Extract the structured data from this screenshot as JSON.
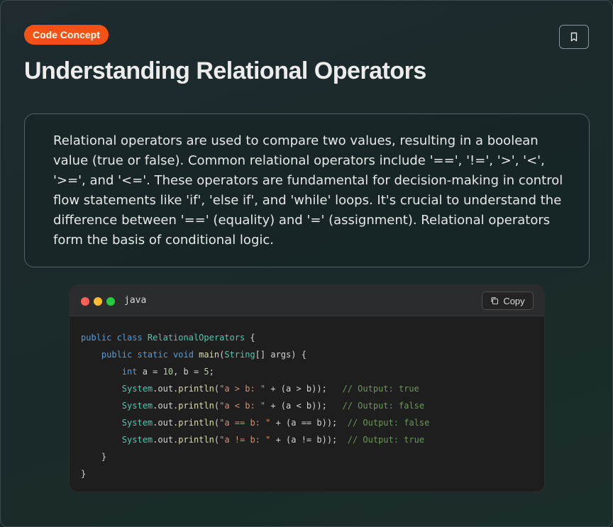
{
  "badge": {
    "label": "Code Concept"
  },
  "header": {
    "title": "Understanding Relational Operators",
    "bookmark_icon": "bookmark-icon"
  },
  "description": {
    "text": "Relational operators are used to compare two values, resulting in a boolean value (true or false). Common relational operators include '==', '!=', '>', '<', '>=', and '<='. These operators are fundamental for decision-making in control flow statements like 'if', 'else if', and 'while' loops. It's crucial to understand the difference between '==' (equality) and '=' (assignment). Relational operators form the basis of conditional logic."
  },
  "code_block": {
    "language": "java",
    "copy_label": "Copy",
    "copy_icon": "copy-icon",
    "window_dots": [
      "#ff5f56",
      "#ffbd2e",
      "#27c93f"
    ],
    "lines": [
      [
        {
          "t": "public class ",
          "c": "kw"
        },
        {
          "t": "RelationalOperators",
          "c": "ty"
        },
        {
          "t": " {",
          "c": ""
        }
      ],
      [
        {
          "t": "    public static void ",
          "c": "kw"
        },
        {
          "t": "main",
          "c": "fn"
        },
        {
          "t": "(",
          "c": ""
        },
        {
          "t": "String",
          "c": "ty"
        },
        {
          "t": "[] args) {",
          "c": ""
        }
      ],
      [
        {
          "t": "        ",
          "c": ""
        },
        {
          "t": "int",
          "c": "kw"
        },
        {
          "t": " a = ",
          "c": ""
        },
        {
          "t": "10",
          "c": "nu"
        },
        {
          "t": ", b = ",
          "c": ""
        },
        {
          "t": "5",
          "c": "nu"
        },
        {
          "t": ";",
          "c": ""
        }
      ],
      [
        {
          "t": "        ",
          "c": ""
        },
        {
          "t": "System",
          "c": "ty"
        },
        {
          "t": ".out.",
          "c": ""
        },
        {
          "t": "println",
          "c": "fn"
        },
        {
          "t": "(",
          "c": ""
        },
        {
          "t": "\"a > b: \"",
          "c": "st"
        },
        {
          "t": " + (a > b));   ",
          "c": ""
        },
        {
          "t": "// Output: true",
          "c": "cm"
        }
      ],
      [
        {
          "t": "        ",
          "c": ""
        },
        {
          "t": "System",
          "c": "ty"
        },
        {
          "t": ".out.",
          "c": ""
        },
        {
          "t": "println",
          "c": "fn"
        },
        {
          "t": "(",
          "c": ""
        },
        {
          "t": "\"a < b: \"",
          "c": "st"
        },
        {
          "t": " + (a < b));   ",
          "c": ""
        },
        {
          "t": "// Output: false",
          "c": "cm"
        }
      ],
      [
        {
          "t": "        ",
          "c": ""
        },
        {
          "t": "System",
          "c": "ty"
        },
        {
          "t": ".out.",
          "c": ""
        },
        {
          "t": "println",
          "c": "fn"
        },
        {
          "t": "(",
          "c": ""
        },
        {
          "t": "\"a == b: \"",
          "c": "st"
        },
        {
          "t": " + (a == b));  ",
          "c": ""
        },
        {
          "t": "// Output: false",
          "c": "cm"
        }
      ],
      [
        {
          "t": "        ",
          "c": ""
        },
        {
          "t": "System",
          "c": "ty"
        },
        {
          "t": ".out.",
          "c": ""
        },
        {
          "t": "println",
          "c": "fn"
        },
        {
          "t": "(",
          "c": ""
        },
        {
          "t": "\"a != b: \"",
          "c": "st"
        },
        {
          "t": " + (a != b));  ",
          "c": ""
        },
        {
          "t": "// Output: true",
          "c": "cm"
        }
      ],
      [
        {
          "t": "    }",
          "c": ""
        }
      ],
      [
        {
          "t": "}",
          "c": ""
        }
      ]
    ]
  },
  "colors": {
    "accent": "#f25314",
    "background": "#1b2a2a",
    "code_bg": "#1e1e1e"
  }
}
